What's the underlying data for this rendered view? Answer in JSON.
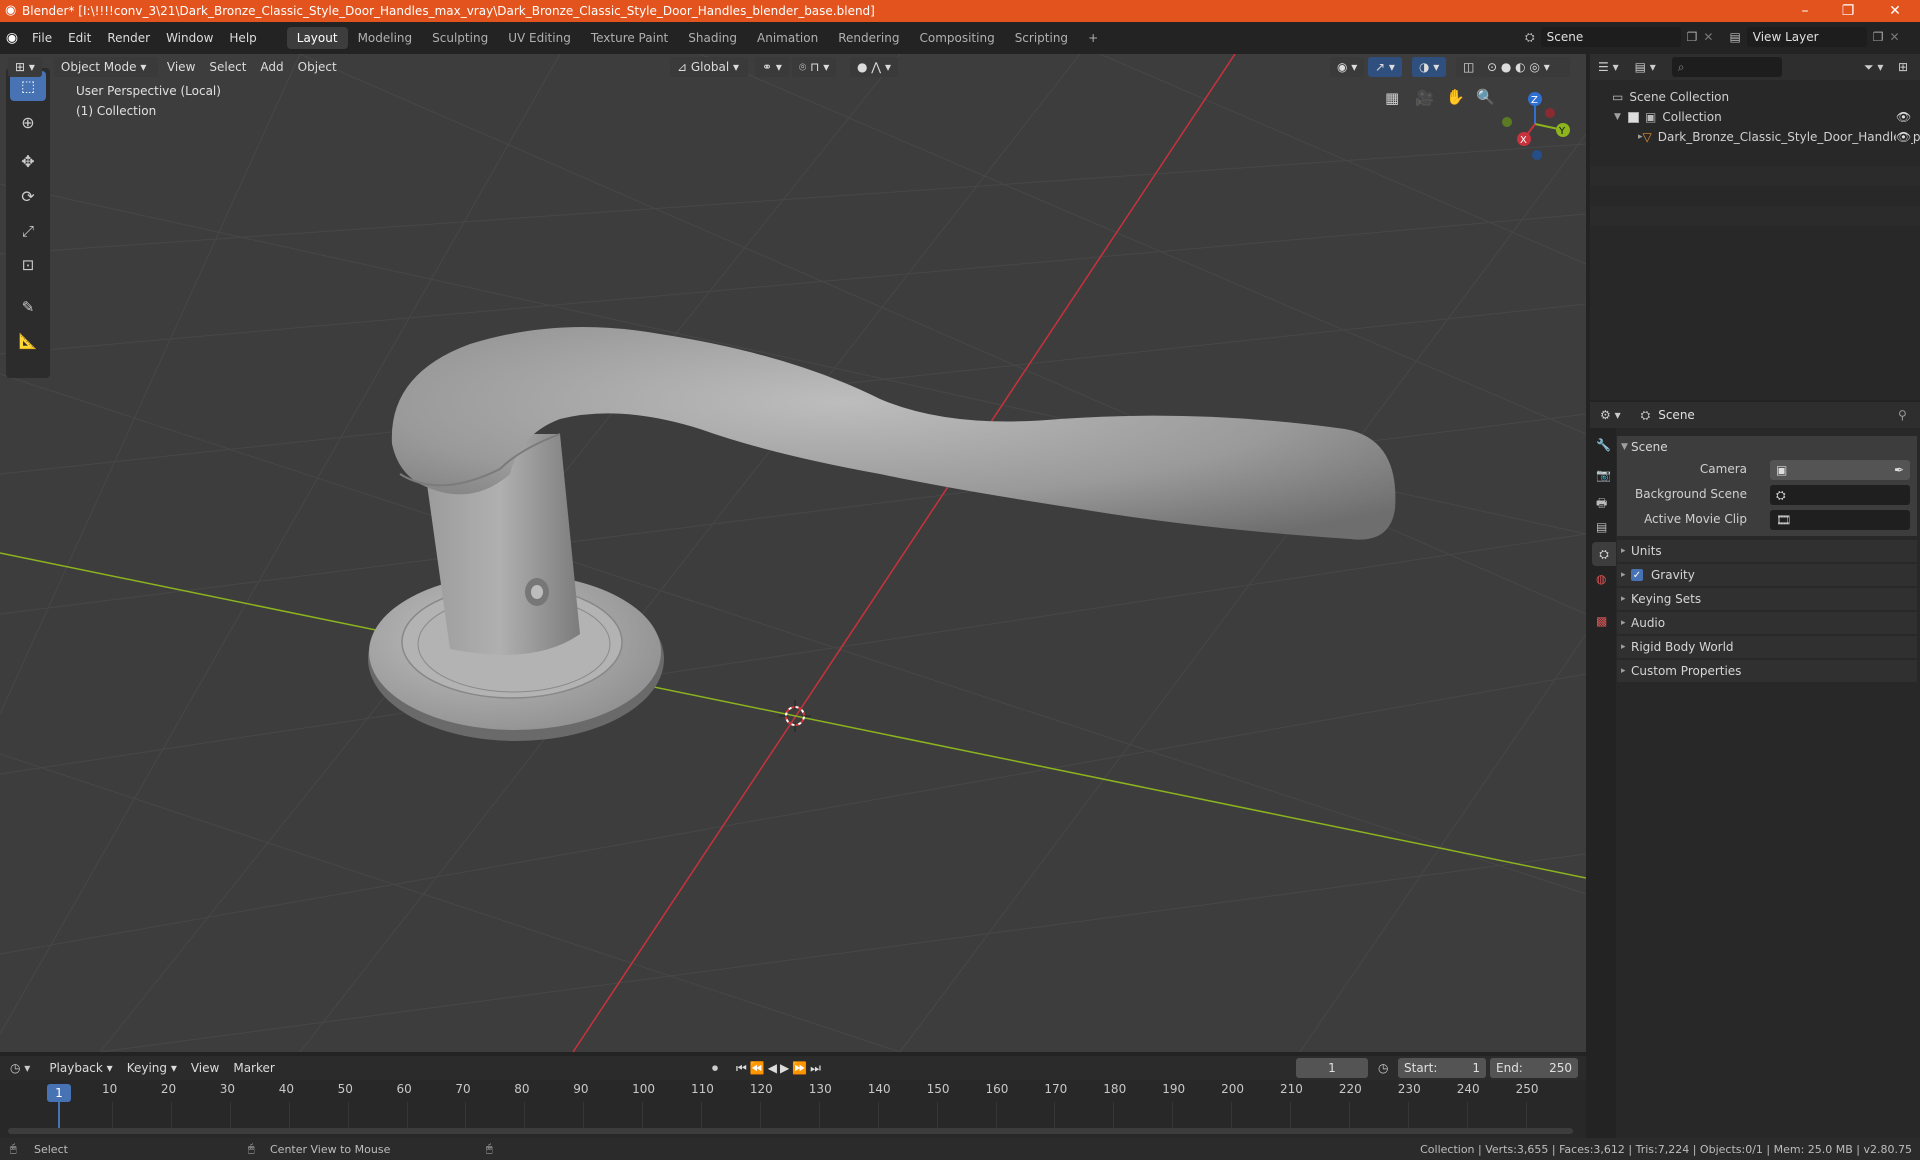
{
  "window": {
    "title": "Blender* [I:\\!!!!conv_3\\21\\Dark_Bronze_Classic_Style_Door_Handles_max_vray\\Dark_Bronze_Classic_Style_Door_Handles_blender_base.blend]",
    "minimize": "–",
    "maximize": "❐",
    "close": "✕"
  },
  "menu": {
    "items": [
      "File",
      "Edit",
      "Render",
      "Window",
      "Help"
    ]
  },
  "workspaces": [
    "Layout",
    "Modeling",
    "Sculpting",
    "UV Editing",
    "Texture Paint",
    "Shading",
    "Animation",
    "Rendering",
    "Compositing",
    "Scripting"
  ],
  "active_workspace": "Layout",
  "scene_field": "Scene",
  "view_layer_field": "View Layer",
  "viewport_header": {
    "mode": "Object Mode",
    "menus": [
      "View",
      "Select",
      "Add",
      "Object"
    ],
    "orientation": "Global"
  },
  "viewport": {
    "perspective": "User Perspective (Local)",
    "collection": "(1) Collection"
  },
  "gizmo": {
    "x": "X",
    "y": "Y",
    "z": "Z"
  },
  "outliner": {
    "root": "Scene Collection",
    "collection": "Collection",
    "object": "Dark_Bronze_Classic_Style_Door_Handles_p"
  },
  "properties": {
    "context": "Scene",
    "panel": "Scene",
    "fields": {
      "camera": "Camera",
      "background_scene": "Background Scene",
      "active_movie_clip": "Active Movie Clip"
    },
    "sections": [
      "Units",
      "Gravity",
      "Keying Sets",
      "Audio",
      "Rigid Body World",
      "Custom Properties"
    ]
  },
  "timeline": {
    "menus": [
      "Playback",
      "Keying",
      "View",
      "Marker"
    ],
    "current_frame": "1",
    "start_label": "Start:",
    "start": "1",
    "end_label": "End:",
    "end": "250",
    "ticks": [
      "1",
      "10",
      "20",
      "30",
      "40",
      "50",
      "60",
      "70",
      "80",
      "90",
      "100",
      "110",
      "120",
      "130",
      "140",
      "150",
      "160",
      "170",
      "180",
      "190",
      "200",
      "210",
      "220",
      "230",
      "240",
      "250"
    ]
  },
  "status": {
    "select": "Select",
    "center": "Center View to Mouse",
    "stats": "Collection | Verts:3,655 | Faces:3,612 | Tris:7,224 | Objects:0/1 | Mem: 25.0 MB | v2.80.75"
  },
  "colors": {
    "title_bar": "#e2531d",
    "viewport": "#3d3d3d",
    "accent": "#4772b3",
    "x_axis": "#c8323c",
    "y_axis": "#8cb41e"
  }
}
